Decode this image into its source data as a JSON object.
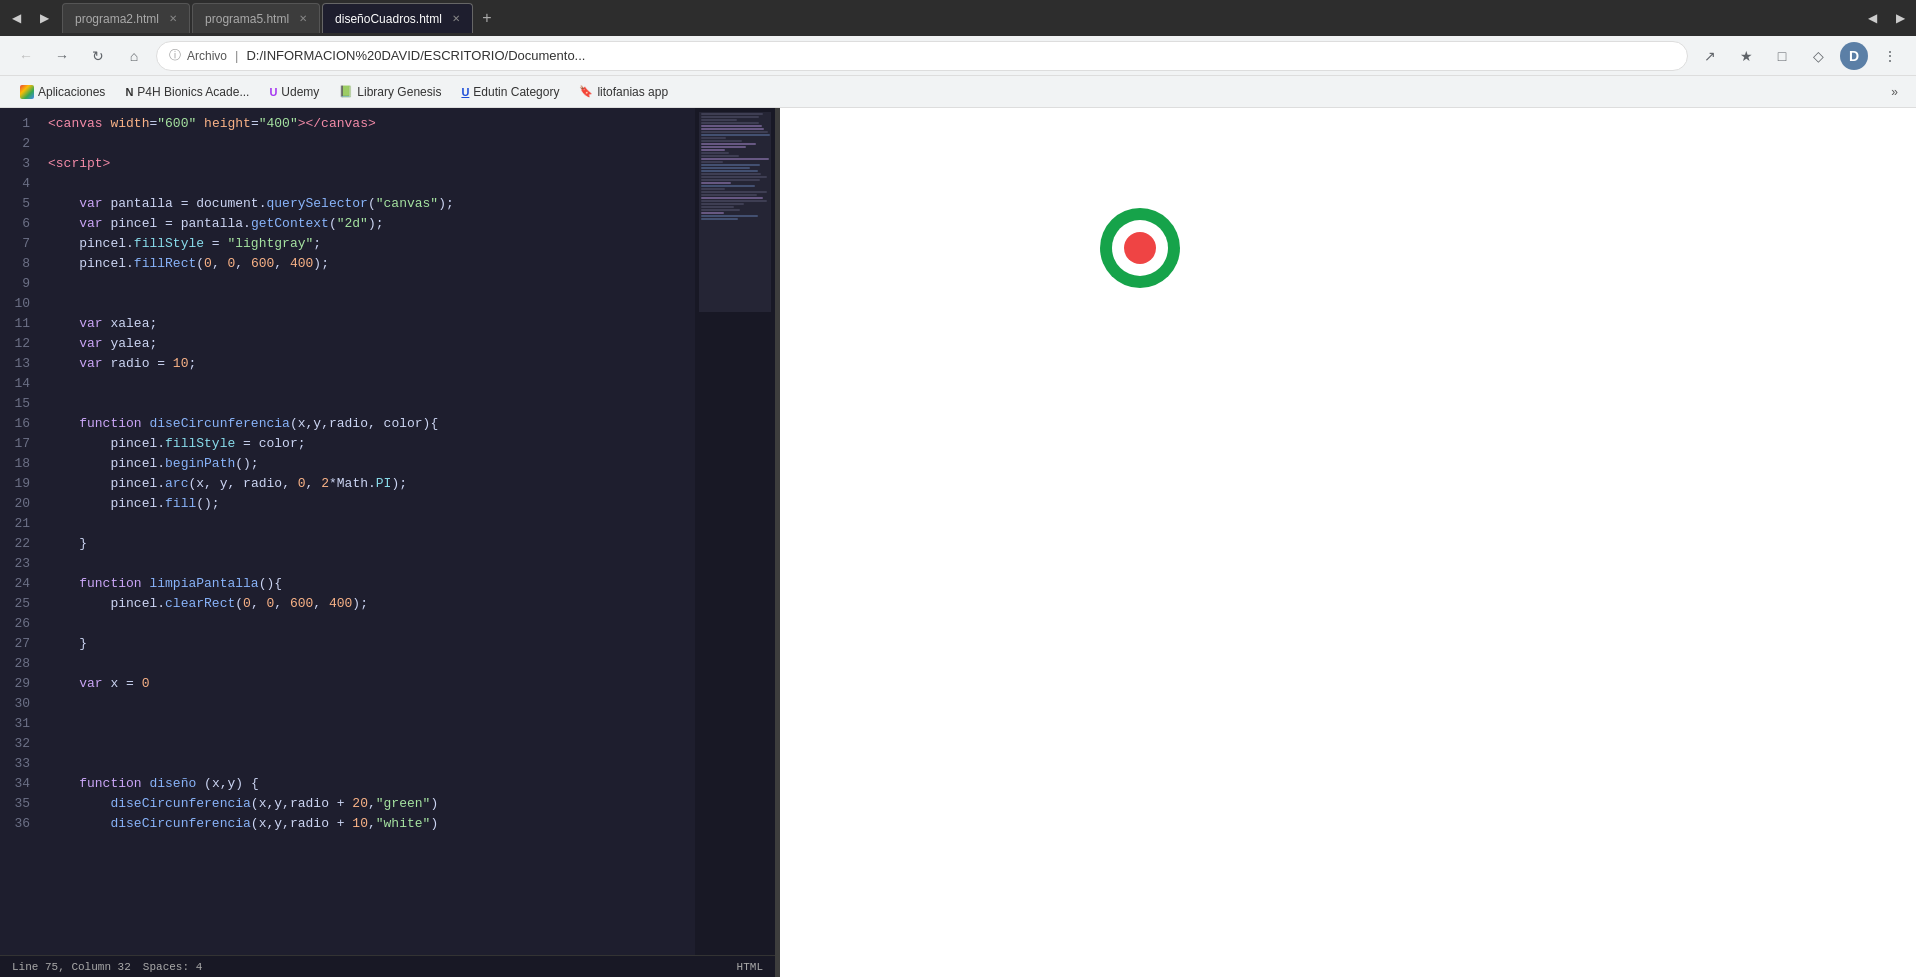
{
  "browser": {
    "tabs": [
      {
        "id": "tab1",
        "label": "programa2.html",
        "active": false
      },
      {
        "id": "tab2",
        "label": "programa5.html",
        "active": false
      },
      {
        "id": "tab3",
        "label": "diseñoCuadros.html",
        "active": true
      }
    ],
    "address": {
      "protocol_icon": "🔒",
      "label": "Archivo",
      "url": "D:/INFORMACION%20DAVID/ESCRITORIO/Documento...",
      "share_icon": "↗",
      "star_icon": "☆"
    },
    "bookmarks": [
      {
        "id": "bm1",
        "favicon": "⬛",
        "label": "Aplicaciones"
      },
      {
        "id": "bm2",
        "favicon": "N",
        "label": "P4H Bionics Acade..."
      },
      {
        "id": "bm3",
        "favicon": "U",
        "label": "Udemy"
      },
      {
        "id": "bm4",
        "favicon": "📚",
        "label": "Library Genesis"
      },
      {
        "id": "bm5",
        "favicon": "U",
        "label": "Edutin Category"
      },
      {
        "id": "bm6",
        "favicon": "🔖",
        "label": "litofanias app"
      }
    ],
    "bookmarks_more": "»"
  },
  "editor": {
    "status": {
      "line_col": "Line 75, Column 32",
      "spaces": "Spaces: 4",
      "language": "HTML"
    },
    "code_lines": [
      {
        "num": 1,
        "html": "<span class='tag'>&lt;canvas</span> <span class='attr'>width</span>=<span class='val'>\"600\"</span> <span class='attr'>height</span>=<span class='val'>\"400\"</span><span class='tag'>&gt;&lt;/canvas&gt;</span>"
      },
      {
        "num": 2,
        "html": ""
      },
      {
        "num": 3,
        "html": "<span class='tag'>&lt;script&gt;</span>"
      },
      {
        "num": 4,
        "html": ""
      },
      {
        "num": 5,
        "html": "    <span class='kw'>var</span> <span class='var-name'>pantalla</span> = <span class='var-name'>document</span>.<span class='fn'>querySelector</span>(<span class='str'>\"canvas\"</span>);"
      },
      {
        "num": 6,
        "html": "    <span class='kw'>var</span> <span class='var-name'>pincel</span> = <span class='var-name'>pantalla</span>.<span class='fn'>getContext</span>(<span class='str'>\"2d\"</span>);"
      },
      {
        "num": 7,
        "html": "    <span class='var-name'>pincel</span>.<span class='prop'>fillStyle</span> = <span class='str'>\"lightgray\"</span>;"
      },
      {
        "num": 8,
        "html": "    <span class='var-name'>pincel</span>.<span class='fn'>fillRect</span>(<span class='num'>0</span>, <span class='num'>0</span>, <span class='num'>600</span>, <span class='num'>400</span>);"
      },
      {
        "num": 9,
        "html": ""
      },
      {
        "num": 10,
        "html": ""
      },
      {
        "num": 11,
        "html": "    <span class='kw'>var</span> <span class='var-name'>xalea</span>;"
      },
      {
        "num": 12,
        "html": "    <span class='kw'>var</span> <span class='var-name'>yalea</span>;"
      },
      {
        "num": 13,
        "html": "    <span class='kw'>var</span> <span class='var-name'>radio</span> = <span class='num'>10</span>;"
      },
      {
        "num": 14,
        "html": ""
      },
      {
        "num": 15,
        "html": ""
      },
      {
        "num": 16,
        "html": "    <span class='kw'>function</span> <span class='fn'>diseCircunferencia</span>(<span class='var-name'>x</span>,<span class='var-name'>y</span>,<span class='var-name'>radio</span>, <span class='var-name'>color</span>){"
      },
      {
        "num": 17,
        "html": "        <span class='var-name'>pincel</span>.<span class='prop'>fillStyle</span> = <span class='var-name'>color</span>;"
      },
      {
        "num": 18,
        "html": "        <span class='var-name'>pincel</span>.<span class='fn'>beginPath</span>();"
      },
      {
        "num": 19,
        "html": "        <span class='var-name'>pincel</span>.<span class='fn'>arc</span>(<span class='var-name'>x</span>, <span class='var-name'>y</span>, <span class='var-name'>radio</span>, <span class='num'>0</span>, <span class='num'>2</span>*<span class='var-name'>Math</span>.<span class='prop'>PI</span>);"
      },
      {
        "num": 20,
        "html": "        <span class='var-name'>pincel</span>.<span class='fn'>fill</span>();"
      },
      {
        "num": 21,
        "html": ""
      },
      {
        "num": 22,
        "html": "    }"
      },
      {
        "num": 23,
        "html": ""
      },
      {
        "num": 24,
        "html": "    <span class='kw'>function</span> <span class='fn'>limpiaPantalla</span>(){"
      },
      {
        "num": 25,
        "html": "        <span class='var-name'>pincel</span>.<span class='fn'>clearRect</span>(<span class='num'>0</span>, <span class='num'>0</span>, <span class='num'>600</span>, <span class='num'>400</span>);"
      },
      {
        "num": 26,
        "html": ""
      },
      {
        "num": 27,
        "html": "    }"
      },
      {
        "num": 28,
        "html": ""
      },
      {
        "num": 29,
        "html": "    <span class='kw'>var</span> <span class='var-name'>x</span> = <span class='num'>0</span>"
      },
      {
        "num": 30,
        "html": ""
      },
      {
        "num": 31,
        "html": ""
      },
      {
        "num": 32,
        "html": ""
      },
      {
        "num": 33,
        "html": ""
      },
      {
        "num": 34,
        "html": "    <span class='kw'>function</span> <span class='fn'>diseño</span> (<span class='var-name'>x</span>,<span class='var-name'>y</span>) {"
      },
      {
        "num": 35,
        "html": "        <span class='fn'>diseCircunferencia</span>(<span class='var-name'>x</span>,<span class='var-name'>y</span>,<span class='var-name'>radio</span> + <span class='num'>20</span>,<span class='str'>\"green\"</span>)"
      },
      {
        "num": 36,
        "html": "        <span class='fn'>diseCircunferencia</span>(<span class='var-name'>x</span>,<span class='var-name'>y</span>,<span class='var-name'>radio</span> + <span class='num'>10</span>,<span class='str'>\"white\"</span>)"
      }
    ]
  }
}
